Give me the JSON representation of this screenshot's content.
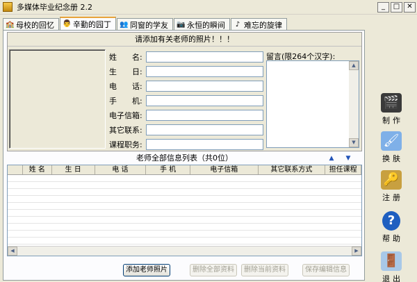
{
  "window": {
    "title": "多媒体毕业纪念册 2.2",
    "min": "_",
    "max": "□",
    "close": "✕"
  },
  "tabs": [
    {
      "label": "母校的回忆",
      "icon": "school-icon",
      "active": false
    },
    {
      "label": "辛勤的园丁",
      "icon": "teacher-icon",
      "active": true
    },
    {
      "label": "同窗的学友",
      "icon": "classmates-icon",
      "active": false
    },
    {
      "label": "永恒的瞬间",
      "icon": "camera-icon",
      "active": false
    },
    {
      "label": "难忘的旋律",
      "icon": "music-icon",
      "active": false
    }
  ],
  "form": {
    "photo_prompt": "请添加有关老师的照片！！！",
    "fields": [
      {
        "label": "姓　　名:",
        "value": ""
      },
      {
        "label": "生　　日:",
        "value": ""
      },
      {
        "label": "电　　话:",
        "value": ""
      },
      {
        "label": "手　　机:",
        "value": ""
      },
      {
        "label": "电子信箱:",
        "value": ""
      },
      {
        "label": "其它联系:",
        "value": ""
      },
      {
        "label": "课程职务:",
        "value": ""
      }
    ],
    "memo_label": "留言(限264个汉字):",
    "memo_value": ""
  },
  "list": {
    "title": "老师全部信息列表（共0位）",
    "columns": [
      "姓 名",
      "生 日",
      "电 话",
      "手 机",
      "电子信箱",
      "其它联系方式",
      "担任课程"
    ],
    "rows": []
  },
  "buttons": {
    "add_photo": "添加老师照片",
    "delete_all": "删除全部资料",
    "delete_current": "删除当前资料",
    "save_edit": "保存编辑信息"
  },
  "side": {
    "make": "制作",
    "skin": "换肤",
    "register": "注册",
    "help": "帮助",
    "exit": "退出"
  }
}
